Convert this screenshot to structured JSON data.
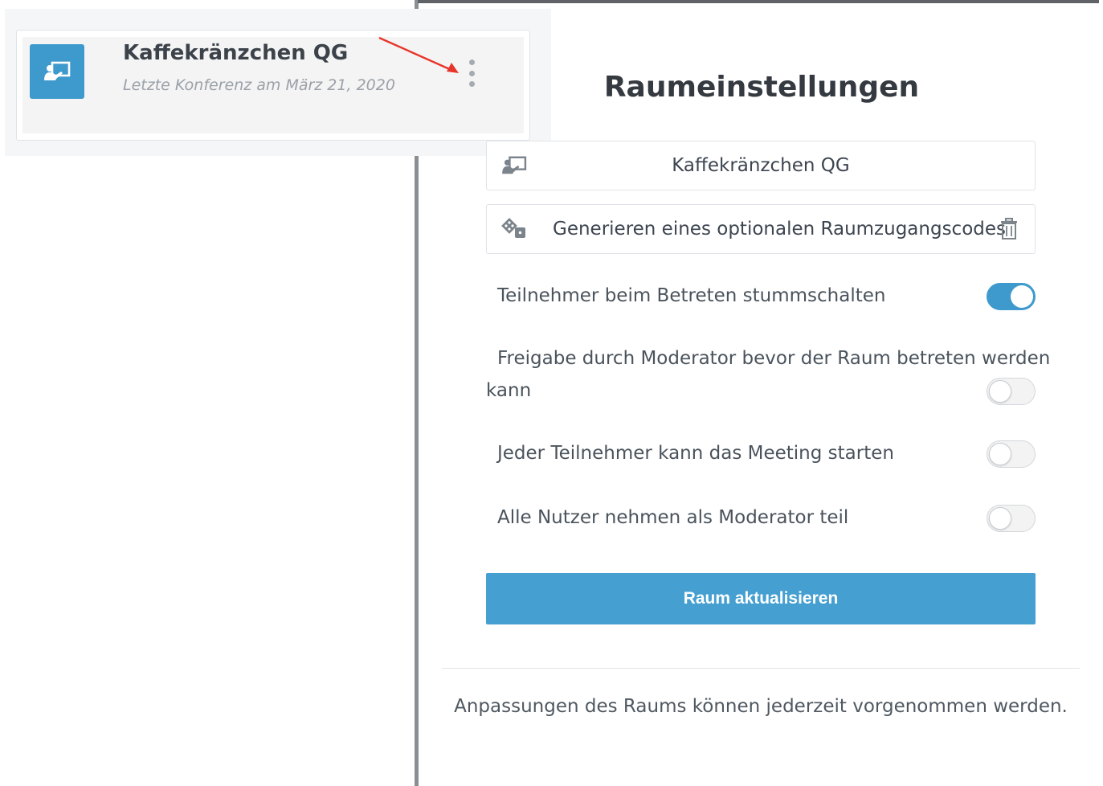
{
  "card": {
    "title": "Kaffekränzchen QG",
    "subtitle": "Letzte Konferenz am März 21, 2020",
    "icon": "room-presentation-icon",
    "menu_icon": "kebab-menu-icon"
  },
  "settings": {
    "title": "Raumeinstellungen",
    "room_name": "Kaffekränzchen QG",
    "access_code_label": "Generieren eines optionalen Raumzugangscodes",
    "options": [
      {
        "label": "Teilnehmer beim Betreten stummschalten",
        "enabled": true
      },
      {
        "label_line1": "Freigabe durch Moderator bevor der Raum betreten werden",
        "label_line2": "kann",
        "enabled": false
      },
      {
        "label": "Jeder Teilnehmer kann das Meeting starten",
        "enabled": false
      },
      {
        "label": "Alle Nutzer nehmen als Moderator teil",
        "enabled": false
      }
    ],
    "update_button": "Raum aktualisieren",
    "footer_note": "Anpassungen des Raums können jederzeit vorgenommen werden."
  },
  "colors": {
    "accent": "#3e9acd",
    "arrow": "#e8352b"
  }
}
